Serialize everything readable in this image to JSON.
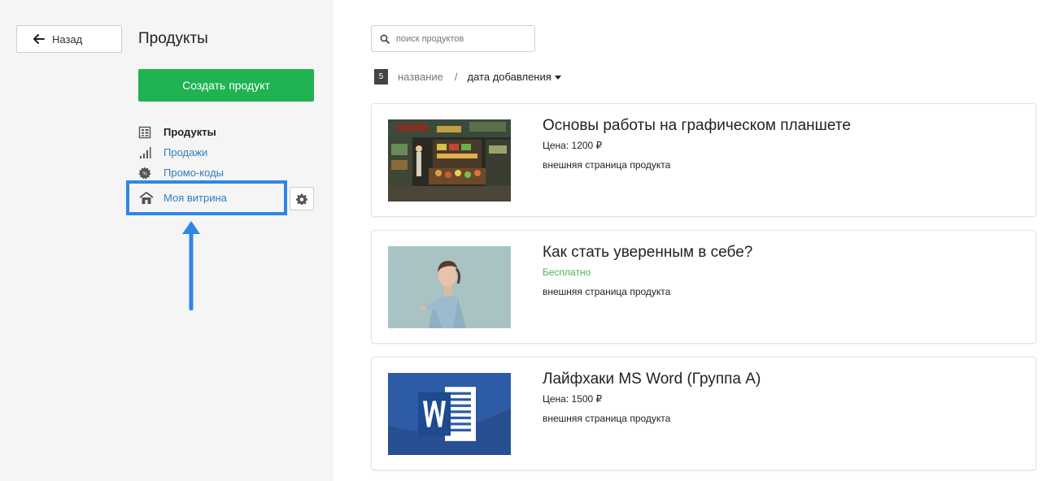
{
  "sidebar": {
    "back_label": "Назад",
    "title": "Продукты",
    "create_label": "Создать продукт",
    "nav": [
      {
        "label": "Продукты",
        "icon": "product-list-icon",
        "active": true
      },
      {
        "label": "Продажи",
        "icon": "bar-chart-icon",
        "active": false
      },
      {
        "label": "Промо-коды",
        "icon": "promo-badge-icon",
        "active": false
      }
    ],
    "storefront_label": "Моя витрина",
    "storefront_icon": "house-icon",
    "settings_icon": "gear-icon"
  },
  "main": {
    "search_placeholder": "поиск продуктов",
    "count": "5",
    "sort_name": "название",
    "sort_separator": "/",
    "sort_date": "дата добавления",
    "products": [
      {
        "title": "Основы работы на графическом планшете",
        "price": "Цена: 1200 ₽",
        "free": false,
        "link": "внешняя страница продукта",
        "image": "street-market-illustration"
      },
      {
        "title": "Как стать уверенным в себе?",
        "price": "Бесплатно",
        "free": true,
        "link": "внешняя страница продукта",
        "image": "woman-portrait-photo"
      },
      {
        "title": "Лайфхаки MS Word (Группа А)",
        "price": "Цена: 1500 ₽",
        "free": false,
        "link": "внешняя страница продукта",
        "image": "ms-word-logo"
      }
    ]
  },
  "colors": {
    "accent_green": "#1fb352",
    "link_blue": "#2d7fc1",
    "highlight_blue": "#2f86ea",
    "free_green": "#3fb94e"
  }
}
